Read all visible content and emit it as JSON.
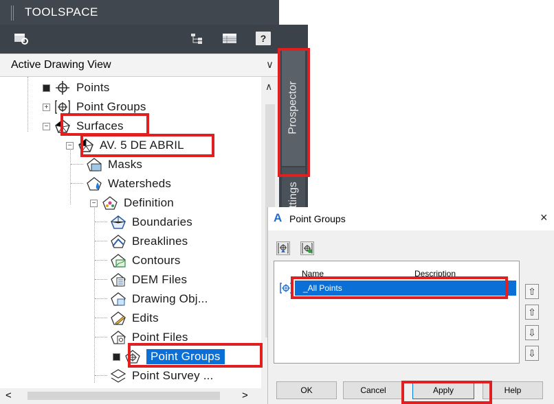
{
  "toolspace": {
    "title": "TOOLSPACE",
    "toolbar": {
      "help_label": "?"
    },
    "view_selector": "Active Drawing View",
    "tabs": [
      "Prospector",
      "Settings"
    ],
    "tree": {
      "items": [
        {
          "label": "Points"
        },
        {
          "label": "Point Groups"
        },
        {
          "label": "Surfaces"
        },
        {
          "label": "AV. 5 DE ABRIL"
        },
        {
          "label": "Masks"
        },
        {
          "label": "Watersheds"
        },
        {
          "label": "Definition"
        },
        {
          "label": "Boundaries"
        },
        {
          "label": "Breaklines"
        },
        {
          "label": "Contours"
        },
        {
          "label": "DEM Files"
        },
        {
          "label": "Drawing Obj..."
        },
        {
          "label": "Edits"
        },
        {
          "label": "Point Files"
        },
        {
          "label": "Point Groups",
          "selected": true
        },
        {
          "label": "Point Survey ..."
        }
      ]
    }
  },
  "dialog": {
    "app_letter": "A",
    "title": "Point Groups",
    "close": "×",
    "columns": {
      "name": "Name",
      "description": "Description"
    },
    "rows": [
      {
        "name": "_All Points",
        "description": ""
      }
    ],
    "order_buttons": [
      "⇧",
      "⇧",
      "⇩",
      "⇩"
    ],
    "buttons": {
      "ok": "OK",
      "cancel": "Cancel",
      "apply": "Apply",
      "help": "Help"
    }
  },
  "colors": {
    "highlight": "#e02020",
    "selection": "#0a6fd6",
    "panel_dark": "#3c4249"
  }
}
